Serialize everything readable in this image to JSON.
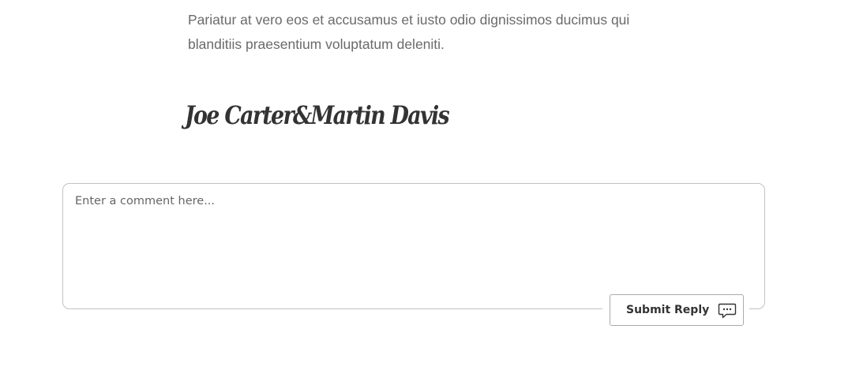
{
  "intro": {
    "text": "Pariatur at vero eos et accusamus et iusto odio dignissimos ducimus qui blanditiis praesentium voluptatum deleniti."
  },
  "signature": {
    "text": "Joe Carter&Martin Davis"
  },
  "comment_form": {
    "placeholder": "Enter a comment here...",
    "value": "",
    "submit_label": "Submit Reply",
    "submit_icon": "chat-bubble-icon"
  }
}
